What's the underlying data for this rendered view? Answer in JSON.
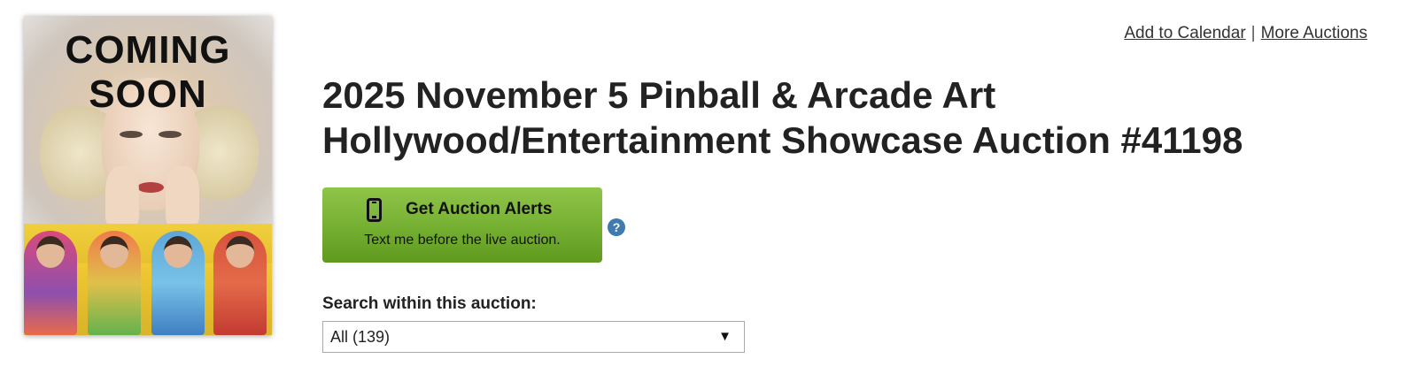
{
  "cover": {
    "title_line1": "COMING",
    "title_line2": "SOON"
  },
  "header_links": {
    "add_to_calendar": "Add to Calendar",
    "separator": "|",
    "more_auctions": "More Auctions"
  },
  "auction": {
    "title_line1": "2025 November 5 Pinball & Arcade Art",
    "title_line2": "Hollywood/Entertainment Showcase Auction #41198"
  },
  "alerts_button": {
    "icon": "phone-icon",
    "title": "Get Auction Alerts",
    "subtitle": "Text me before the live auction.",
    "color": "#77b133"
  },
  "help": {
    "icon": "question-icon",
    "glyph": "?"
  },
  "search": {
    "label": "Search within this auction:",
    "selected": "All (139)",
    "arrow": "▼"
  }
}
